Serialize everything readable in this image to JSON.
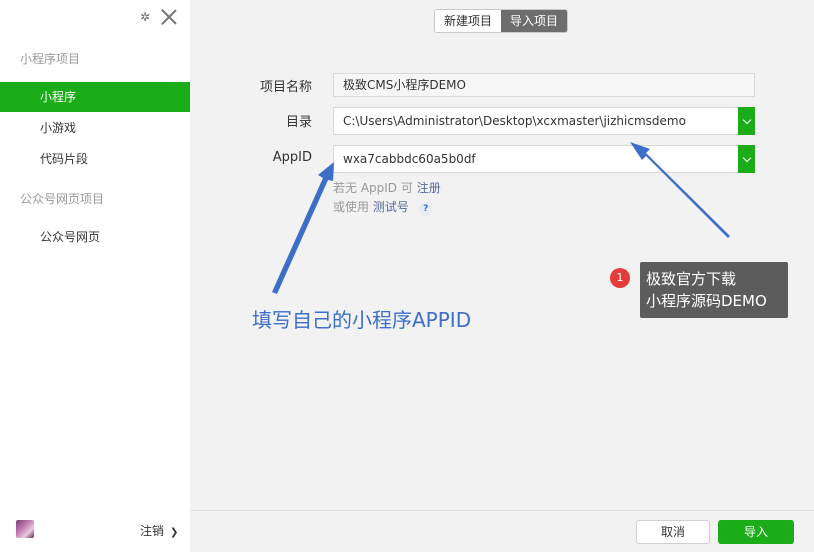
{
  "sidebar": {
    "sections": [
      {
        "title": "小程序项目",
        "items": [
          "小程序",
          "小游戏",
          "代码片段"
        ]
      },
      {
        "title": "公众号网页项目",
        "items": [
          "公众号网页"
        ]
      }
    ],
    "active_item": "小程序",
    "logout_label": "注销",
    "icons": {
      "settings": "gear-icon",
      "close": "close-icon",
      "chevron": "chevron-right-icon"
    }
  },
  "tabs": [
    {
      "label": "新建项目",
      "active": false
    },
    {
      "label": "导入项目",
      "active": true
    }
  ],
  "form": {
    "project_name": {
      "label": "项目名称",
      "value": "极致CMS小程序DEMO"
    },
    "directory": {
      "label": "目录",
      "value": "C:\\Users\\Administrator\\Desktop\\xcxmaster\\jizhicmsdemo"
    },
    "appid": {
      "label": "AppID",
      "value": "wxa7cabbdc60a5b0df"
    },
    "hint1_prefix": "若无 AppID 可",
    "hint1_link": "注册",
    "hint2_prefix": "或使用",
    "hint2_link": "测试号",
    "help_glyph": "?"
  },
  "annotations": {
    "appid_note": "填写自己的小程序APPID",
    "badge_number": "1",
    "callout_lines": [
      "极致官方下载",
      "小程序源码DEMO"
    ]
  },
  "footer": {
    "cancel_label": "取消",
    "import_label": "导入"
  },
  "colors": {
    "accent": "#1aad19",
    "annotation": "#3d6ec9",
    "badge": "#e43b3b",
    "callout_bg": "#5c5c5c"
  }
}
